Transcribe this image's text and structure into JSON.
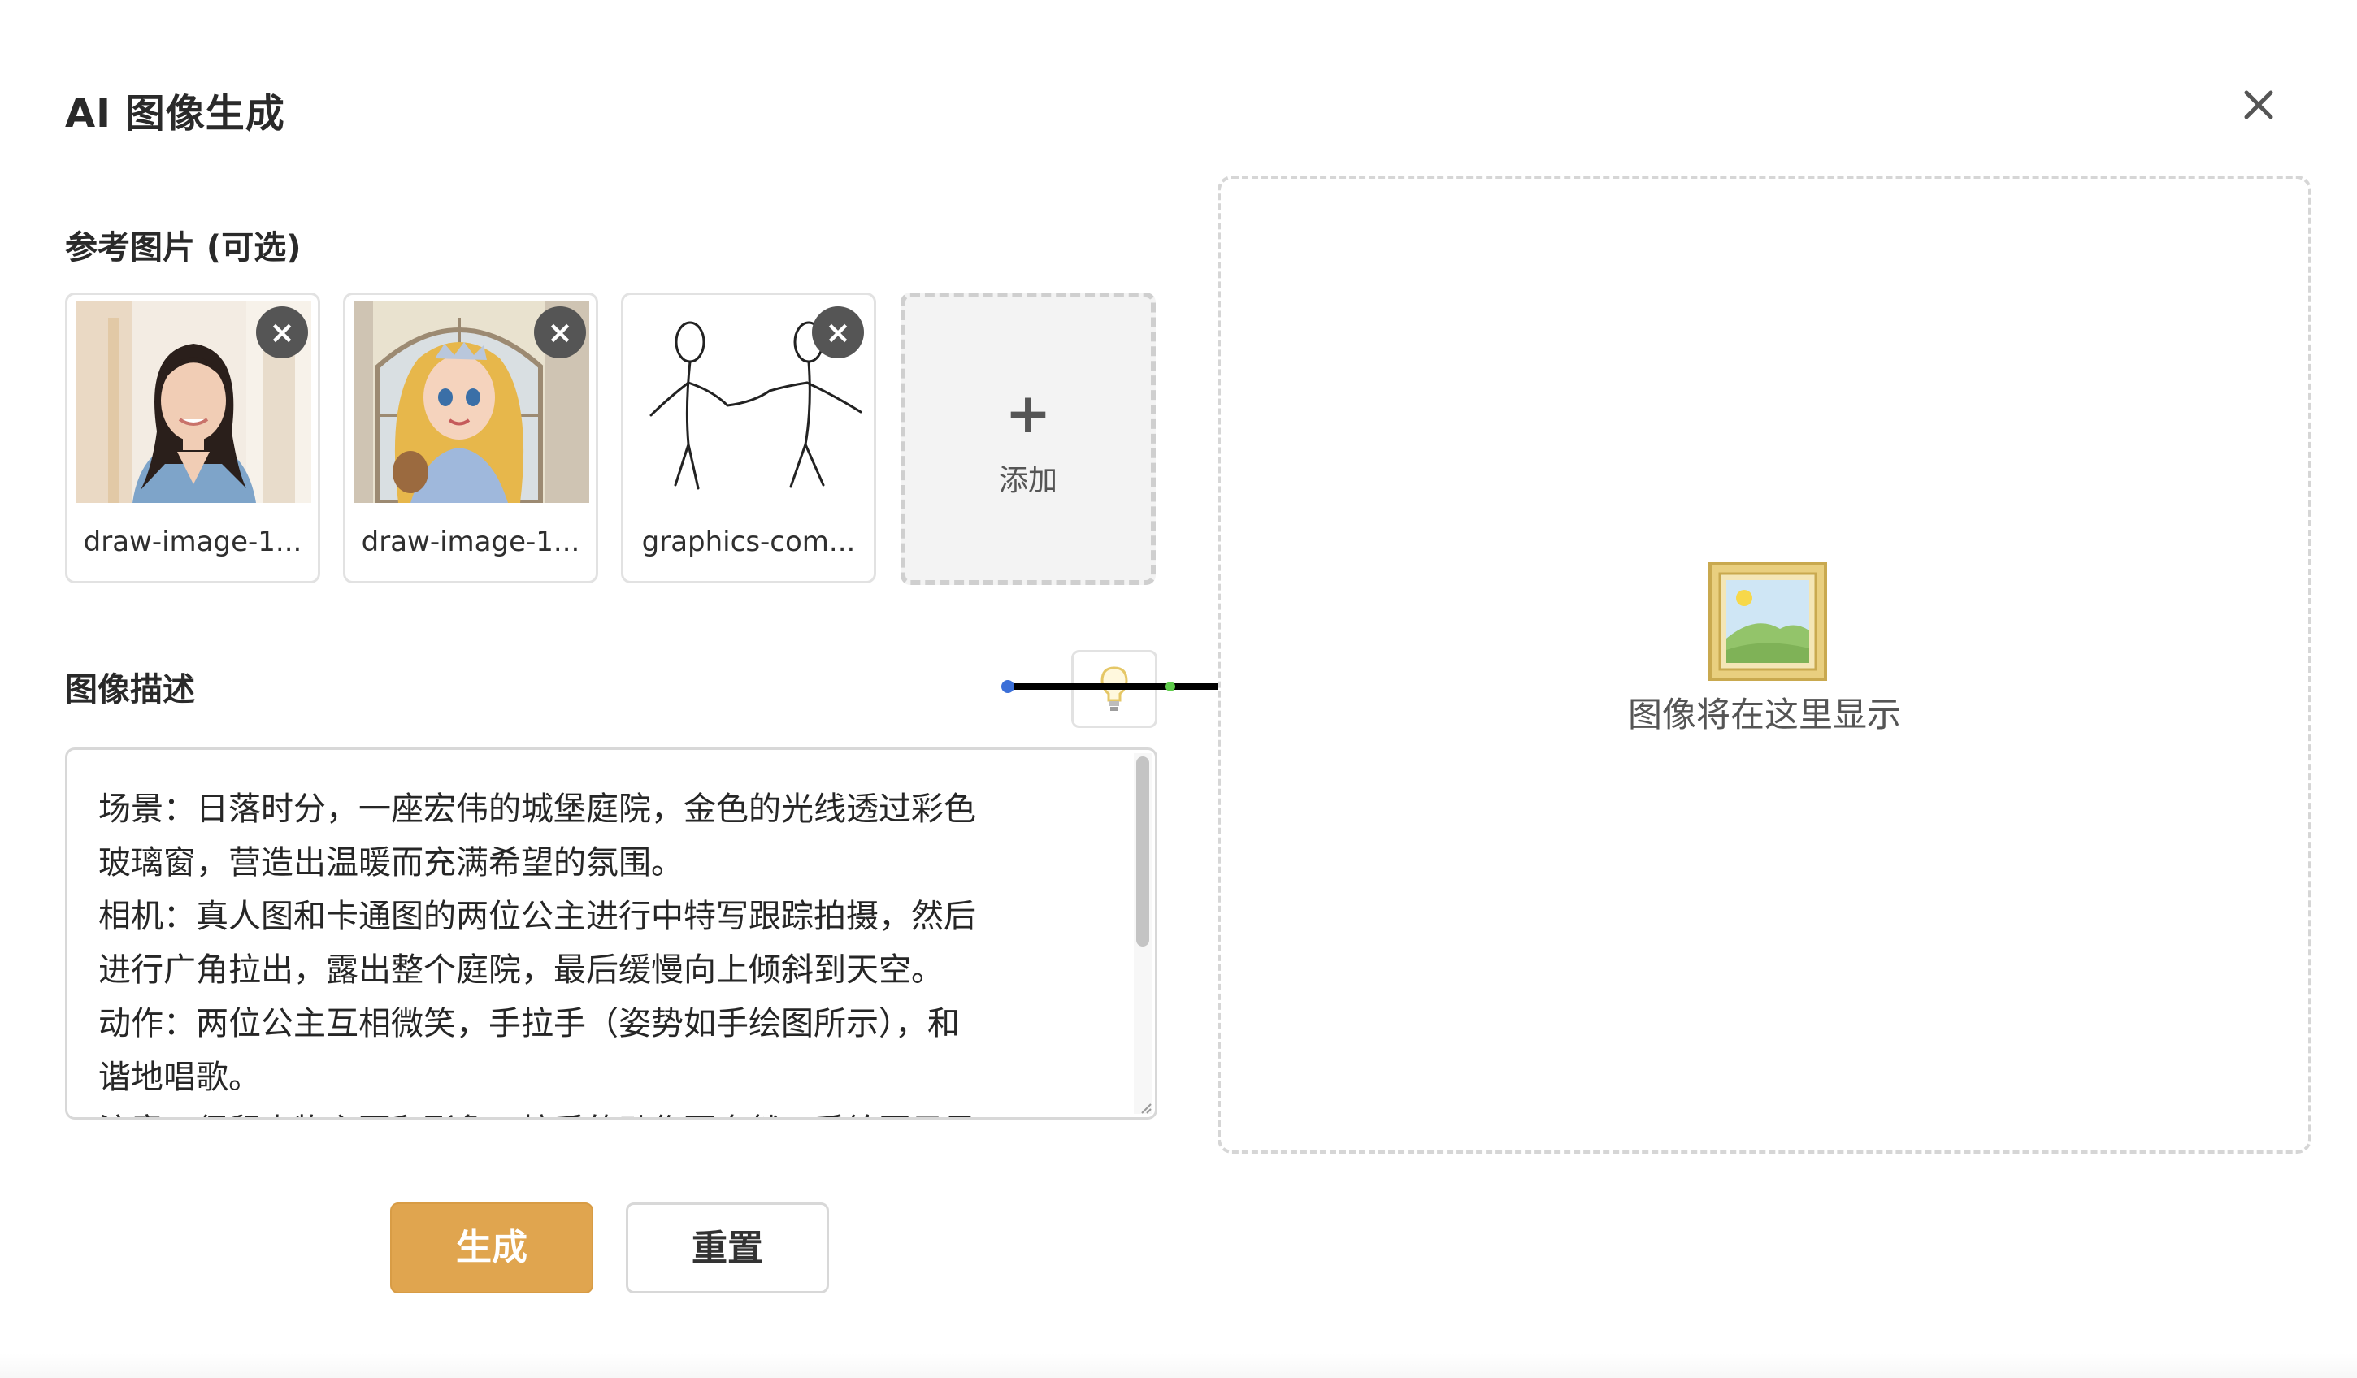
{
  "dialog": {
    "title": "AI 图像生成",
    "close_icon": "close-icon"
  },
  "reference_images": {
    "label": "参考图片 (可选)",
    "items": [
      {
        "name": "draw-image-1...",
        "remove_symbol": "×"
      },
      {
        "name": "draw-image-1...",
        "remove_symbol": "×"
      },
      {
        "name": "graphics-com...",
        "remove_symbol": "×"
      }
    ],
    "add_label": "添加",
    "add_symbol": "+"
  },
  "description": {
    "label": "图像描述",
    "hint_icon": "lightbulb-icon",
    "text": "场景：日落时分，一座宏伟的城堡庭院，金色的光线透过彩色\n玻璃窗，营造出温暖而充满希望的氛围。\n相机：真人图和卡通图的两位公主进行中特写跟踪拍摄，然后\n进行广角拉出，露出整个庭院，最后缓慢向上倾斜到天空。\n动作：两位公主互相微笑，手拉手（姿势如手绘图所示），和\n谐地唱歌。\n注意：保留人物主要和形象，拉手的动作要自然，手绘图只是"
  },
  "actions": {
    "generate_label": "生成",
    "reset_label": "重置",
    "generate_color": "#e0a54f"
  },
  "preview": {
    "placeholder_text": "图像将在这里显示",
    "placeholder_icon": "framed-picture-icon"
  }
}
